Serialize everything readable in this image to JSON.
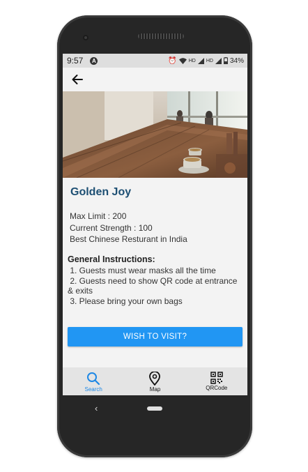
{
  "status": {
    "time": "9:57",
    "a_badge": "A",
    "hd1": "HD",
    "hd2": "HD",
    "battery": "34%"
  },
  "place": {
    "name": "Golden Joy",
    "max_limit": "Max Limit : 200",
    "current_strength": "Current Strength : 100",
    "description": "Best Chinese Resturant in India"
  },
  "instructions": {
    "title": "General Instructions:",
    "items": [
      " 1. Guests must wear masks all the time",
      " 2. Guests need to show QR code at entrance & exits",
      " 3. Please bring your own bags"
    ]
  },
  "actions": {
    "wish_label": "WISH TO VISIT?"
  },
  "nav": {
    "search": "Search",
    "map": "Map",
    "qrcode": "QRCode"
  },
  "colors": {
    "accent": "#2196f3",
    "title": "#1d4f73",
    "active_nav": "#1e88e5"
  },
  "icons": [
    "back-arrow-icon",
    "search-icon",
    "map-pin-icon",
    "qr-code-icon"
  ]
}
